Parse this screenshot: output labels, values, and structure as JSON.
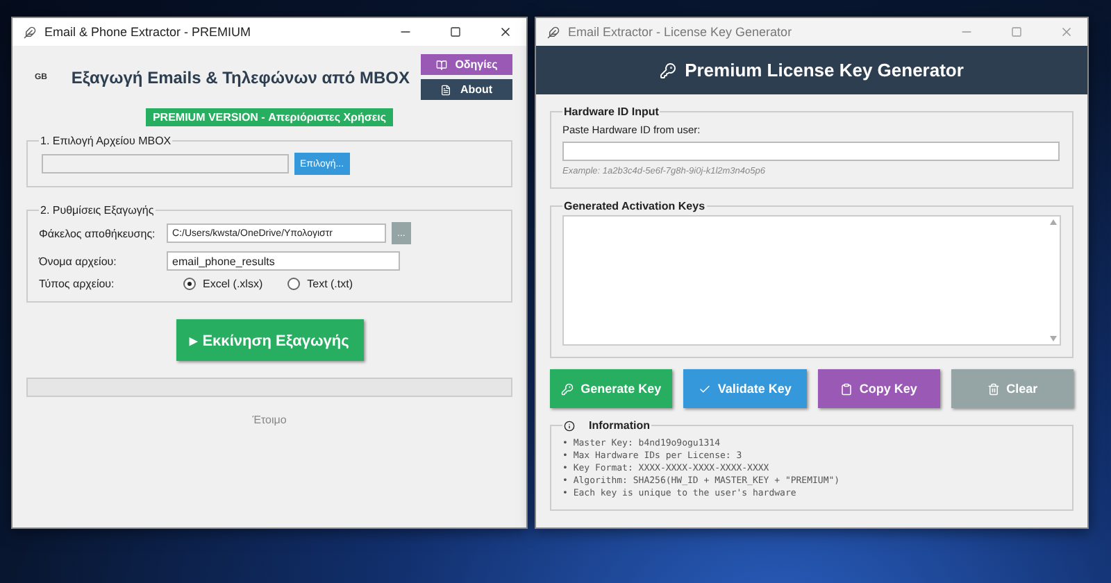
{
  "extractor_window": {
    "title": "Email & Phone Extractor - PREMIUM",
    "language_badge": "GB",
    "heading": "Εξαγωγή Emails & Τηλεφώνων από MBOX",
    "side_buttons": [
      {
        "label": "Οδηγίες",
        "kind": "guide"
      },
      {
        "label": "About",
        "kind": "about"
      }
    ],
    "premium_badge": "PREMIUM VERSION - Απεριόριστες Χρήσεις",
    "file_group": {
      "title": "1. Επιλογή Αρχείου MBOX",
      "browse_button": "Επιλογή..."
    },
    "settings_group": {
      "title": "2. Ρυθμίσεις Εξαγωγής",
      "folder_label": "Φάκελος αποθήκευσης:",
      "folder_value": "C:/Users/kwsta/OneDrive/Υπολογιστr",
      "folder_button": "...",
      "name_label": "Όνομα αρχείου:",
      "name_value": "email_phone_results",
      "type_label": "Τύπος αρχείου:",
      "file_types": [
        {
          "label": "Excel (.xlsx)",
          "selected": true
        },
        {
          "label": "Text (.txt)",
          "selected": false
        }
      ]
    },
    "start_button": "▸ Εκκίνηση Εξαγωγής",
    "progress": {
      "level": 0
    },
    "status": "Έτοιμο"
  },
  "keygen_window": {
    "title": "Email Extractor - License Key Generator",
    "header": "Premium License Key Generator",
    "hardware_group": {
      "title": "Hardware ID Input",
      "prompt": "Paste Hardware ID from user:",
      "example": "Example: 1a2b3c4d-5e6f-7g8h-9i0j-k1l2m3n4o5p6"
    },
    "keys_group": {
      "title": "Generated Activation Keys"
    },
    "actions": [
      {
        "label": "Generate Key",
        "kind": "generate",
        "color": "#27ae60"
      },
      {
        "label": "Validate Key",
        "kind": "validate",
        "color": "#3498db"
      },
      {
        "label": "Copy Key",
        "kind": "copy",
        "color": "#9b59b6"
      },
      {
        "label": "Clear",
        "kind": "clear",
        "color": "#95a5a6"
      }
    ],
    "info_group": {
      "title": "Information",
      "lines": [
        "• Master Key: b4nd19o9ogu1314",
        "• Max Hardware IDs per License: 3",
        "• Key Format: XXXX-XXXX-XXXX-XXXX-XXXX",
        "• Algorithm: SHA256(HW_ID + MASTER_KEY + \"PREMIUM\")",
        "• Each key is unique to the user's hardware"
      ]
    }
  }
}
